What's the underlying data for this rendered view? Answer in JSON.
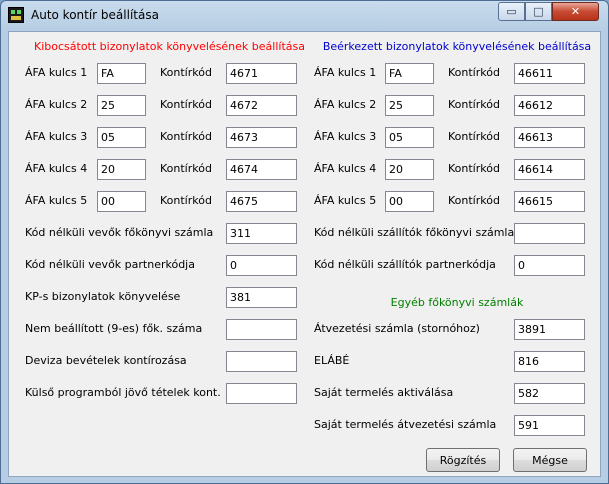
{
  "window": {
    "title": "Auto kontír beállítása",
    "minimize": "▭",
    "maximize": "□",
    "close": "✕"
  },
  "left": {
    "header": "Kibocsátott bizonylatok könyvelésének beállítása",
    "vat_rows": [
      {
        "label": "ÁFA kulcs 1",
        "value": "FA",
        "code_label": "Kontírkód",
        "code": "4671"
      },
      {
        "label": "ÁFA kulcs 2",
        "value": "25",
        "code_label": "Kontírkód",
        "code": "4672"
      },
      {
        "label": "ÁFA kulcs 3",
        "value": "05",
        "code_label": "Kontírkód",
        "code": "4673"
      },
      {
        "label": "ÁFA kulcs 4",
        "value": "20",
        "code_label": "Kontírkód",
        "code": "4674"
      },
      {
        "label": "ÁFA kulcs 5",
        "value": "00",
        "code_label": "Kontírkód",
        "code": "4675"
      }
    ],
    "fields": [
      {
        "label": "Kód nélküli vevők főkönyvi számla",
        "value": "311"
      },
      {
        "label": "Kód nélküli vevők partnerkódja",
        "value": "0"
      },
      {
        "label": "KP-s bizonylatok könyvelése",
        "value": "381"
      },
      {
        "label": "Nem beállított (9-es) fők. száma",
        "value": ""
      },
      {
        "label": "Deviza bevételek kontírozása",
        "value": ""
      },
      {
        "label": "Külső programból jövő tételek kont.",
        "value": ""
      }
    ]
  },
  "right": {
    "header": "Beérkezett bizonylatok könyvelésének beállítása",
    "vat_rows": [
      {
        "label": "ÁFA kulcs 1",
        "value": "FA",
        "code_label": "Kontírkód",
        "code": "46611"
      },
      {
        "label": "ÁFA kulcs 2",
        "value": "25",
        "code_label": "Kontírkód",
        "code": "46612"
      },
      {
        "label": "ÁFA kulcs 3",
        "value": "05",
        "code_label": "Kontírkód",
        "code": "46613"
      },
      {
        "label": "ÁFA kulcs 4",
        "value": "20",
        "code_label": "Kontírkód",
        "code": "46614"
      },
      {
        "label": "ÁFA kulcs 5",
        "value": "00",
        "code_label": "Kontírkód",
        "code": "46615"
      }
    ],
    "fields": [
      {
        "label": "Kód nélküli szállítók főkönyvi számla",
        "value": ""
      },
      {
        "label": "Kód nélküli szállítók partnerkódja",
        "value": "0"
      }
    ],
    "other_header": "Egyéb főkönyvi számlák",
    "other_fields": [
      {
        "label": "Átvezetési számla (stornóhoz)",
        "value": "3891"
      },
      {
        "label": "ELÁBÉ",
        "value": "816"
      },
      {
        "label": "Saját termelés aktiválása",
        "value": "582"
      },
      {
        "label": "Saját termelés átvezetési számla",
        "value": "591"
      }
    ]
  },
  "buttons": {
    "save": "Rögzítés",
    "cancel": "Mégse"
  }
}
